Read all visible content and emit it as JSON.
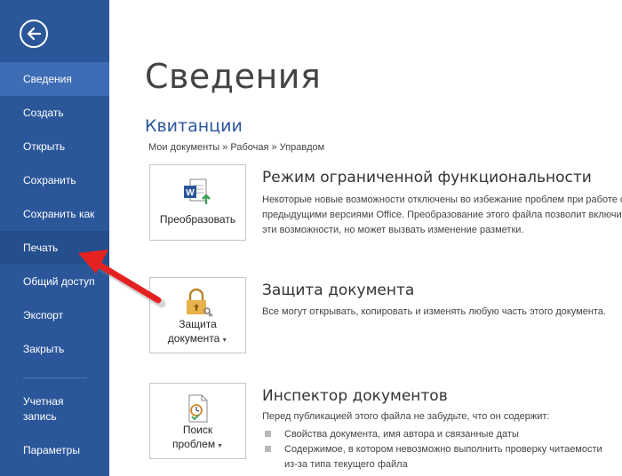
{
  "sidebar": {
    "items": [
      {
        "label": "Сведения"
      },
      {
        "label": "Создать"
      },
      {
        "label": "Открыть"
      },
      {
        "label": "Сохранить"
      },
      {
        "label": "Сохранить как"
      },
      {
        "label": "Печать"
      },
      {
        "label": "Общий доступ"
      },
      {
        "label": "Экспорт"
      },
      {
        "label": "Закрыть"
      },
      {
        "label": "Учетная запись"
      },
      {
        "label": "Параметры"
      }
    ],
    "active_index": 0
  },
  "main": {
    "title": "Сведения",
    "doc_name": "Квитанции",
    "doc_path": "Мои документы » Рабочая » Управдом",
    "sections": [
      {
        "tile_label": "Преобразовать",
        "icon": "word-convert-icon",
        "title": "Режим ограниченной функциональности",
        "desc": "Некоторые новые возможности отключены во избежание проблем при работе с предыдущими версиями Office. Преобразование этого файла позволит включить эти возможности, но может вызвать изменение разметки."
      },
      {
        "tile_label_1": "Защита",
        "tile_label_2": "документа",
        "icon": "lock-key-icon",
        "title": "Защита документа",
        "desc": "Все могут открывать, копировать и изменять любую часть этого документа."
      },
      {
        "tile_label_1": "Поиск",
        "tile_label_2": "проблем",
        "icon": "inspect-document-icon",
        "title": "Инспектор документов",
        "desc": "Перед публикацией этого файла не забудьте, что он содержит:",
        "bullets": [
          "Свойства документа, имя автора и связанные даты",
          "Содержимое, в котором невозможно выполнить проверку читаемости",
          "из-за типа текущего файла"
        ]
      }
    ]
  },
  "colors": {
    "sidebar": "#2b579a",
    "accent": "#2b579a",
    "annotation_arrow": "#e52222"
  }
}
